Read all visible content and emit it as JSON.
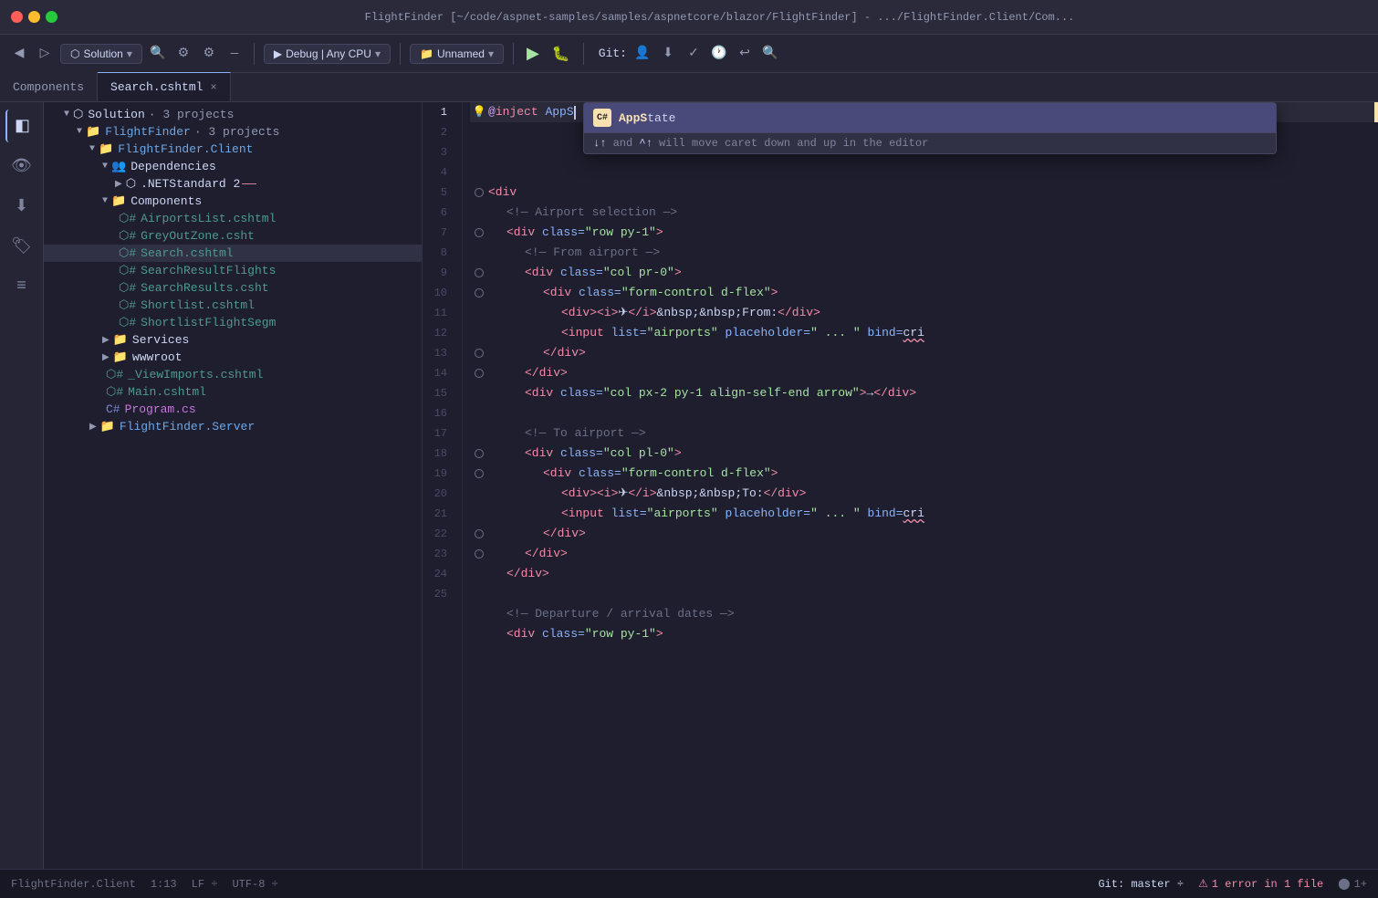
{
  "titleBar": {
    "title": "FlightFinder [~/code/aspnet-samples/samples/aspnetcore/blazor/FlightFinder] - .../FlightFinder.Client/Com..."
  },
  "toolbar": {
    "configLabel": "Debug | Any CPU",
    "projectLabel": "Unnamed",
    "gitLabel": "Git:",
    "runIcon": "▶",
    "debugIcon": "🐛"
  },
  "tabs": [
    {
      "label": "Components",
      "active": false
    },
    {
      "label": "Search.cshtml",
      "active": true,
      "close": "×"
    }
  ],
  "sidebar": {
    "solutionLabel": "Solution",
    "solutionSub": "· 3 projects",
    "tree": [
      {
        "indent": 0,
        "arrow": "▼",
        "icon": "folder",
        "label": "FlightFinder",
        "sub": "· 3 projects",
        "color": "blue"
      },
      {
        "indent": 1,
        "arrow": "▼",
        "icon": "folder",
        "label": "FlightFinder.Client",
        "color": "blue"
      },
      {
        "indent": 2,
        "arrow": "▼",
        "icon": "dep",
        "label": "Dependencies",
        "color": "blue"
      },
      {
        "indent": 3,
        "arrow": "▶",
        "icon": "dep",
        "label": ".NETStandard 2",
        "color": "dep"
      },
      {
        "indent": 2,
        "arrow": "▼",
        "icon": "folder",
        "label": "Components",
        "color": "folder"
      },
      {
        "indent": 3,
        "arrow": "",
        "icon": "cshtml",
        "label": "AirportsList.cshtml",
        "color": "teal"
      },
      {
        "indent": 3,
        "arrow": "",
        "icon": "cshtml",
        "label": "GreyOutZone.csht",
        "color": "teal"
      },
      {
        "indent": 3,
        "arrow": "",
        "icon": "cshtml",
        "label": "Search.cshtml",
        "color": "teal",
        "selected": true
      },
      {
        "indent": 3,
        "arrow": "",
        "icon": "cshtml",
        "label": "SearchResultFlights",
        "color": "teal"
      },
      {
        "indent": 3,
        "arrow": "",
        "icon": "cshtml",
        "label": "SearchResults.csht",
        "color": "teal"
      },
      {
        "indent": 3,
        "arrow": "",
        "icon": "cshtml",
        "label": "Shortlist.cshtml",
        "color": "teal"
      },
      {
        "indent": 3,
        "arrow": "",
        "icon": "cshtml",
        "label": "ShortlistFlightSegm",
        "color": "teal"
      },
      {
        "indent": 2,
        "arrow": "▶",
        "icon": "folder",
        "label": "Services",
        "color": "folder"
      },
      {
        "indent": 2,
        "arrow": "▶",
        "icon": "folder",
        "label": "wwwroot",
        "color": "folder"
      },
      {
        "indent": 2,
        "arrow": "",
        "icon": "cshtml",
        "label": "_ViewImports.cshtml",
        "color": "teal"
      },
      {
        "indent": 2,
        "arrow": "",
        "icon": "cshtml",
        "label": "Main.cshtml",
        "color": "teal"
      },
      {
        "indent": 2,
        "arrow": "",
        "icon": "cs",
        "label": "Program.cs",
        "color": "cs"
      },
      {
        "indent": 1,
        "arrow": "▶",
        "icon": "folder",
        "label": "FlightFinder.Server",
        "color": "blue"
      }
    ]
  },
  "editor": {
    "lines": [
      {
        "num": 1,
        "content": "@inject AppS",
        "type": "inject-line"
      },
      {
        "num": 2,
        "content": "",
        "type": "empty"
      },
      {
        "num": 3,
        "content": "<div",
        "type": "div-open"
      },
      {
        "num": 4,
        "content": "    <!—  Airport selection  —>",
        "type": "comment"
      },
      {
        "num": 5,
        "content": "    <div class=\"row py-1\">",
        "type": "tag"
      },
      {
        "num": 6,
        "content": "        <!—  From airport  —>",
        "type": "comment"
      },
      {
        "num": 7,
        "content": "        <div class=\"col pr-0\">",
        "type": "tag"
      },
      {
        "num": 8,
        "content": "            <div class=\"form-control d-flex\">",
        "type": "tag"
      },
      {
        "num": 9,
        "content": "                <div><i>✈</i>&nbsp;&nbsp;From:</div>",
        "type": "tag"
      },
      {
        "num": 10,
        "content": "                <input list=\"airports\" placeholder=\" ... \" bind=cri",
        "type": "tag"
      },
      {
        "num": 11,
        "content": "            </div>",
        "type": "tag"
      },
      {
        "num": 12,
        "content": "        </div>",
        "type": "tag"
      },
      {
        "num": 13,
        "content": "        <div class=\"col px-2 py-1 align-self-end arrow\">→</div>",
        "type": "tag"
      },
      {
        "num": 14,
        "content": "",
        "type": "empty"
      },
      {
        "num": 15,
        "content": "        <!—  To airport  —>",
        "type": "comment"
      },
      {
        "num": 16,
        "content": "        <div class=\"col pl-0\">",
        "type": "tag"
      },
      {
        "num": 17,
        "content": "            <div class=\"form-control d-flex\">",
        "type": "tag"
      },
      {
        "num": 18,
        "content": "                <div><i>✈</i>&nbsp;&nbsp;To:</div>",
        "type": "tag"
      },
      {
        "num": 19,
        "content": "                <input list=\"airports\" placeholder=\" ... \" bind=cri",
        "type": "tag"
      },
      {
        "num": 20,
        "content": "            </div>",
        "type": "tag"
      },
      {
        "num": 21,
        "content": "        </div>",
        "type": "tag"
      },
      {
        "num": 22,
        "content": "    </div>",
        "type": "tag"
      },
      {
        "num": 23,
        "content": "",
        "type": "empty"
      },
      {
        "num": 24,
        "content": "    <!—  Departure / arrival dates  —>",
        "type": "comment"
      },
      {
        "num": 25,
        "content": "    <div class=\"row py-1\">",
        "type": "tag"
      }
    ]
  },
  "autocomplete": {
    "items": [
      {
        "icon": "C#",
        "label": "AppState",
        "selected": true
      }
    ],
    "hint": "↓↑ and ^↑ will move caret down and up in the editor"
  },
  "statusBar": {
    "filePath": "FlightFinder.Client",
    "position": "1:13",
    "lineEnding": "LF ÷",
    "encoding": "UTF-8 ÷",
    "branch": "Git: master ÷",
    "errorCount": "1 error in 1 file",
    "warningCount": ""
  }
}
